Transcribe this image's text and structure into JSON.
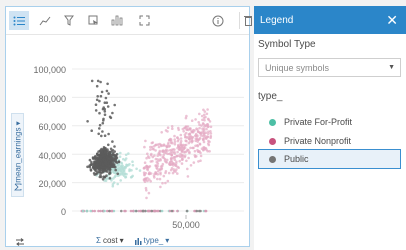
{
  "chart": {
    "yaxis_field": "mean_earnings",
    "y_ticks": [
      "100,000",
      "80,000",
      "60,000",
      "40,000",
      "20,000",
      "0"
    ],
    "x_ticks": [
      "50,000"
    ],
    "x_field_cost": "cost",
    "x_field_type": "type_"
  },
  "legend": {
    "title": "Legend",
    "symbol_type_label": "Symbol Type",
    "symbol_type_value": "Unique symbols",
    "group_label": "type_",
    "items": [
      {
        "label": "Private For-Profit",
        "color": "#4dbfa5"
      },
      {
        "label": "Private Nonprofit",
        "color": "#c8537e"
      },
      {
        "label": "Public",
        "color": "#757575"
      }
    ]
  },
  "colors": {
    "accent": "#2b86c9",
    "public": "#5a5a5a",
    "nonprofit_light": "#e8b7cb",
    "forprofit_light": "#bfe3dd"
  },
  "chart_data": {
    "type": "scatter",
    "xlabel": "cost",
    "ylabel": "mean_earnings",
    "ylim": [
      0,
      110000
    ],
    "y_ticks": [
      0,
      20000,
      40000,
      60000,
      80000,
      100000
    ],
    "x_ticks": [
      50000
    ],
    "series": [
      {
        "name": "Public",
        "cluster_center": [
          15000,
          35000
        ]
      },
      {
        "name": "Private Nonprofit",
        "cluster_center": [
          42000,
          45000
        ]
      },
      {
        "name": "Private For-Profit",
        "cluster_center": [
          25000,
          32000
        ]
      }
    ]
  }
}
